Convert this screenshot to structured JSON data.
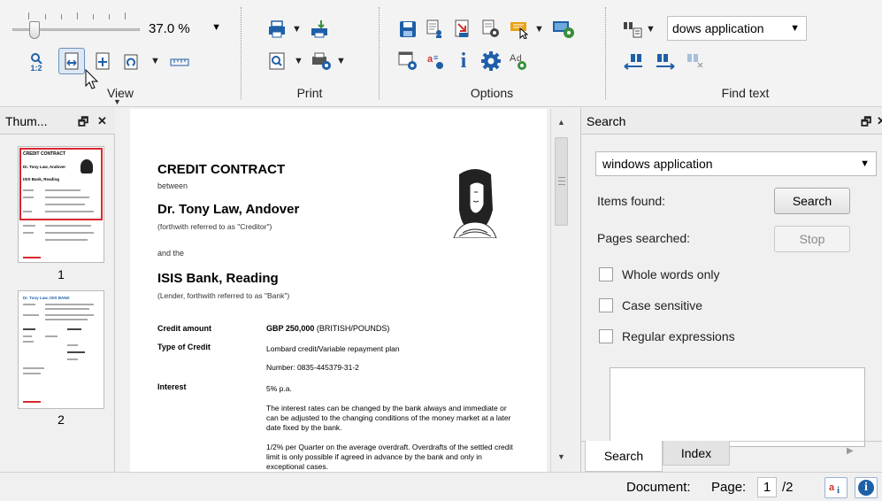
{
  "ribbon": {
    "view": {
      "title": "View",
      "zoom_value": "37.0 %",
      "zoom_label": "1:2",
      "zoom_slider_fraction": 0.08
    },
    "print": {
      "title": "Print"
    },
    "options": {
      "title": "Options"
    },
    "find": {
      "title": "Find text",
      "search_value": "dows application"
    }
  },
  "thumbnails": {
    "title": "Thum...",
    "pages": [
      {
        "number": "1",
        "header_title": "CREDIT CONTRACT",
        "subtitle": "Dr. Tony Law, Andover",
        "bank": "ISIS Bank, Reading"
      },
      {
        "number": "2",
        "header_title": "Dr. Tony Law, ISIS BANK"
      }
    ]
  },
  "document": {
    "title": "CREDIT CONTRACT",
    "between": "between",
    "party1": "Dr. Tony Law, Andover",
    "party1_note": "(forthwith referred to as \"Creditor\")",
    "and_the": "and the",
    "party2": "ISIS Bank, Reading",
    "party2_note": "(Lender, forthwith referred to as \"Bank\")",
    "rows": [
      {
        "label": "Credit amount",
        "value_bold": "GBP 250,000",
        "value_rest": " (BRITISH/POUNDS)"
      },
      {
        "label": "Type of Credit",
        "value_bold": "",
        "value_rest": "Lombard credit/Variable repayment plan"
      },
      {
        "label": "",
        "value_bold": "",
        "value_rest": "Number: 0835-445379-31-2"
      },
      {
        "label": "Interest",
        "value_bold": "",
        "value_rest": "5% p.a."
      }
    ],
    "para1": "The interest rates can be changed by the bank always and immediate or can be adjusted to the changing conditions of the money market at a later date fixed by the bank.",
    "para2": "1/2% per Quarter on the average overdraft. Overdrafts of the settled credit limit is only possible if agreed in advance by the bank and only in exceptional cases."
  },
  "search_panel": {
    "title": "Search",
    "query": "windows application",
    "items_found_label": "Items found:",
    "search_button": "Search",
    "pages_searched_label": "Pages searched:",
    "stop_button": "Stop",
    "whole_words": "Whole words only",
    "case_sensitive": "Case sensitive",
    "regex": "Regular expressions",
    "tabs": [
      "Search",
      "Index"
    ]
  },
  "status": {
    "document_label": "Document:",
    "page_label": "Page:",
    "page_current": "1",
    "page_total": "/2"
  },
  "colors": {
    "accent_blue": "#1f5fa8",
    "thumb_selected": "#d9272e",
    "icon_orange": "#e8a317",
    "icon_green": "#3b8f3b",
    "icon_red": "#cc3333"
  }
}
